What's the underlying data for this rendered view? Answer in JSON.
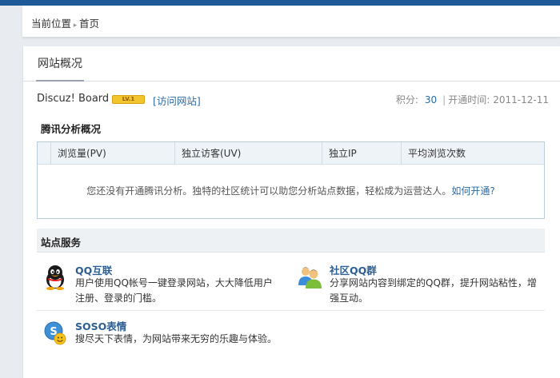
{
  "breadcrumb": {
    "current_label": "当前位置",
    "home": "首页"
  },
  "page": {
    "title": "网站概况"
  },
  "site": {
    "name": "Discuz! Board",
    "level": "LV.1",
    "visit_link": "[访问网站]",
    "score_label": "积分:",
    "score_value": "30",
    "open_time_label": "开通时间:",
    "open_time_value": "2011-12-11"
  },
  "analytics": {
    "title": "腾讯分析概况",
    "columns": [
      "浏览量(PV)",
      "独立访客(UV)",
      "独立IP",
      "平均浏览次数"
    ],
    "message": "您还没有开通腾讯分析。独特的社区统计可以助您分析站点数据，轻松成为运营达人。",
    "message_link": "如何开通?"
  },
  "services": {
    "title": "站点服务",
    "items": [
      {
        "name": "QQ互联",
        "desc": "用户使用QQ帐号一键登录网站，大大降低用户注册、登录的门槛。",
        "icon": "qq-penguin-icon"
      },
      {
        "name": "社区QQ群",
        "desc": "分享网站内容到绑定的QQ群，提升网站粘性，增强互动。",
        "icon": "qq-group-icon"
      },
      {
        "name": "SOSO表情",
        "desc": "搜尽天下表情，为网站带来无穷的乐趣与体验。",
        "icon": "soso-emoticon-icon"
      }
    ]
  }
}
